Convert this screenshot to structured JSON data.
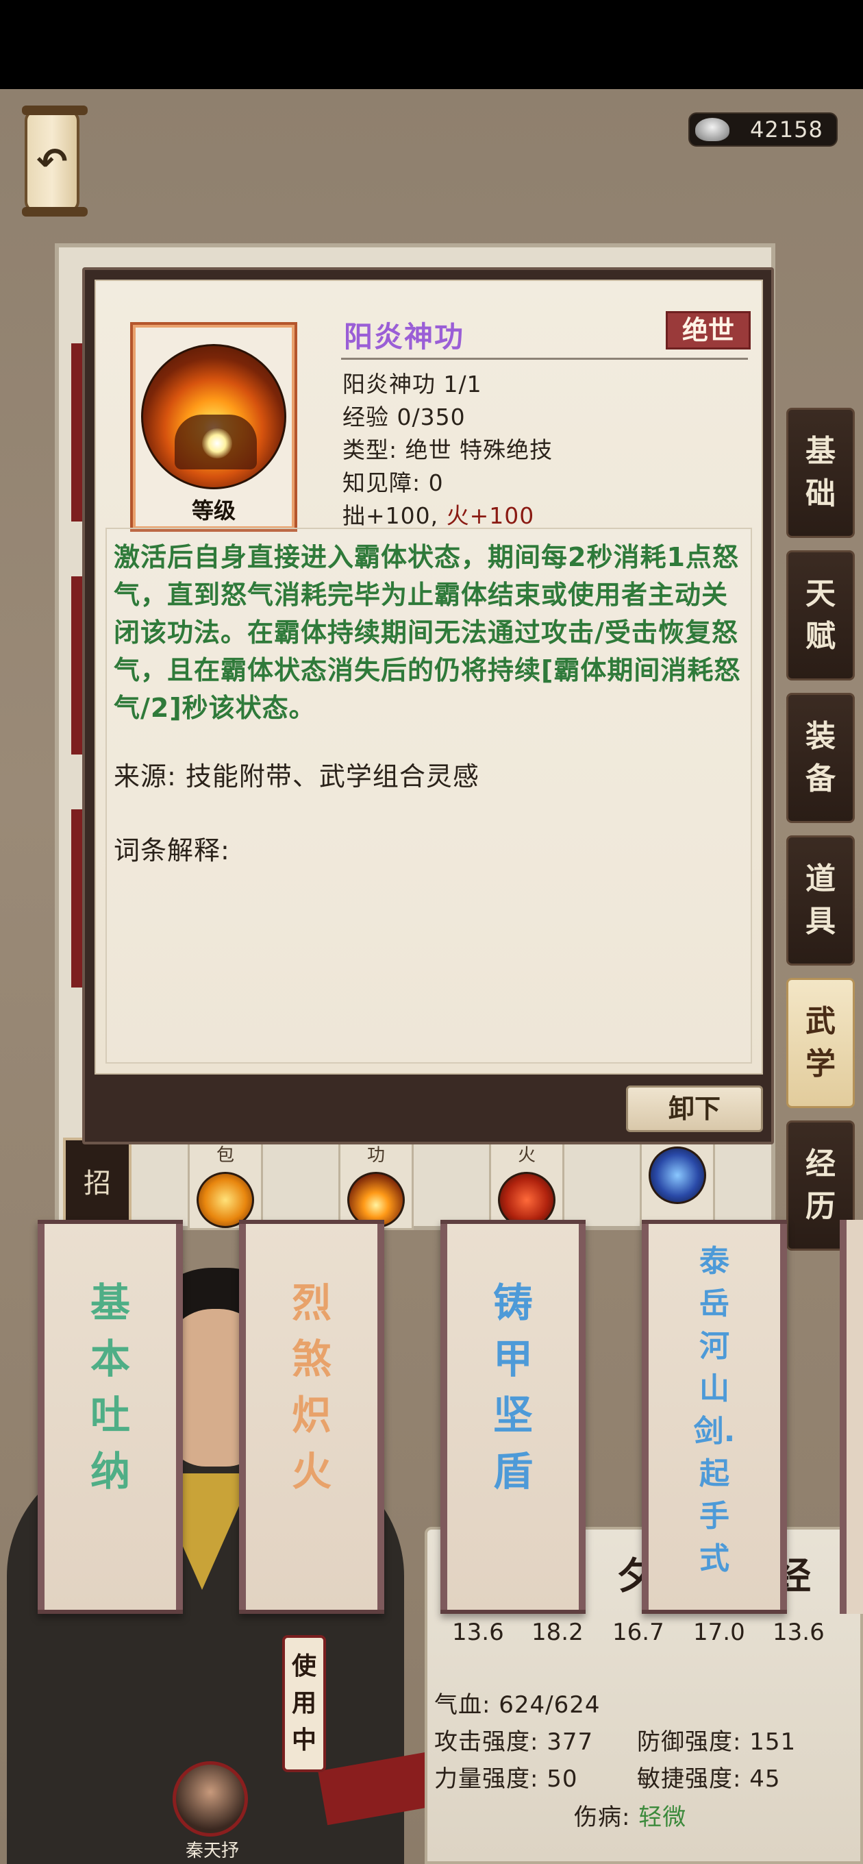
{
  "currency": {
    "amount": "42158",
    "icon": "silver-ingot-icon"
  },
  "nav": {
    "back_icon": "back-arrow-icon",
    "back_glyph": "↶"
  },
  "side_tabs": [
    {
      "label": "基础",
      "c1": "基",
      "c2": "础",
      "active": false
    },
    {
      "label": "天赋",
      "c1": "天",
      "c2": "赋",
      "active": false
    },
    {
      "label": "装备",
      "c1": "装",
      "c2": "备",
      "active": false
    },
    {
      "label": "道具",
      "c1": "道",
      "c2": "具",
      "active": false
    },
    {
      "label": "武学",
      "c1": "武",
      "c2": "学",
      "active": true
    },
    {
      "label": "经历",
      "c1": "经",
      "c2": "历",
      "active": false
    }
  ],
  "slots": [
    {
      "label": "招",
      "char": "招"
    },
    {
      "char": "包"
    },
    {
      "char": "功"
    },
    {
      "char": "火"
    },
    {
      "char": ""
    }
  ],
  "skill_detail": {
    "icon_caption": "等级",
    "name": "阳炎神功",
    "rarity": "绝世",
    "level_line": "阳炎神功 1/1",
    "exp_line": "经验 0/350",
    "type_line": "类型: 绝世 特殊绝技",
    "barrier_line": "知见障: 0",
    "bonus_main": "拙+100, ",
    "bonus_fire": "火+100",
    "description": "激活后自身直接进入霸体状态，期间每2秒消耗1点怒气，直到怒气消耗完毕为止霸体结束或使用者主动关闭该功法。在霸体持续期间无法通过攻击/受击恢复怒气，且在霸体状态消失后的仍将持续[霸体期间消耗怒气/2]秒该状态。",
    "source": "来源: 技能附带、武学组合灵感",
    "terms": "词条解释:",
    "unequip_label": "卸下",
    "colors": {
      "name": "#9a5ed6",
      "description": "#2f7a3a",
      "rarity_bg": "#9a3a3a",
      "fire": "#8a1a12"
    }
  },
  "technique_scrolls": [
    {
      "name": "基本吐纳",
      "chars": [
        "基",
        "本",
        "吐",
        "纳"
      ],
      "color": "#4fae86"
    },
    {
      "name": "烈煞炽火",
      "chars": [
        "烈",
        "煞",
        "炽",
        "火"
      ],
      "color": "#e8a26a"
    },
    {
      "name": "铸甲坚盾",
      "chars": [
        "铸",
        "甲",
        "坚",
        "盾"
      ],
      "color": "#4d9ad8"
    },
    {
      "name": "泰岳河山剑.起手式",
      "chars": [
        "泰",
        "岳",
        "河",
        "山",
        "剑.",
        "起",
        "手",
        "式"
      ],
      "color": "#4d9ad8"
    }
  ],
  "in_use": {
    "chars": [
      "使",
      "用",
      "中"
    ]
  },
  "character": {
    "name": "秦天抒"
  },
  "stats": {
    "title_left": "夕",
    "title_right": "经",
    "attributes": [
      "13.6",
      "18.2",
      "16.7",
      "17.0",
      "13.6"
    ],
    "hp": "气血: 624/624",
    "attack": "攻击强度: 377",
    "defense": "防御强度: 151",
    "strength": "力量强度: 50",
    "agility": "敏捷强度: 45",
    "injury_label": "伤病: ",
    "injury_value": "轻微"
  }
}
